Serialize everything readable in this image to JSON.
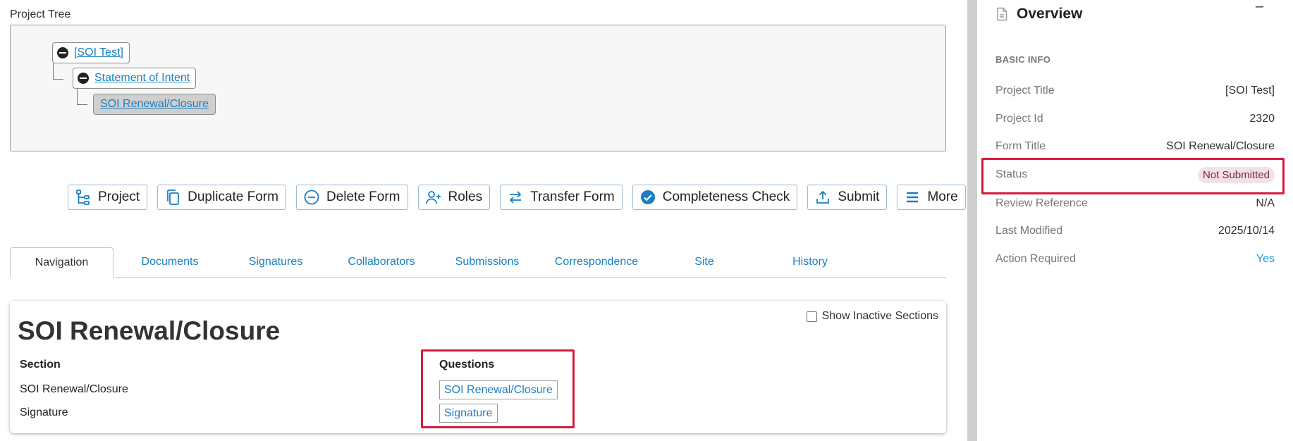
{
  "project_tree": {
    "label": "Project Tree",
    "nodes": [
      "[SOI Test]",
      "Statement of Intent",
      "SOI Renewal/Closure"
    ]
  },
  "toolbar": {
    "buttons": [
      {
        "label": "Project",
        "icon": "hierarchy-icon"
      },
      {
        "label": "Duplicate Form",
        "icon": "copy-icon"
      },
      {
        "label": "Delete Form",
        "icon": "minus-circle-icon"
      },
      {
        "label": "Roles",
        "icon": "user-plus-icon"
      },
      {
        "label": "Transfer Form",
        "icon": "transfer-arrows-icon"
      },
      {
        "label": "Completeness Check",
        "icon": "check-circle-icon"
      },
      {
        "label": "Submit",
        "icon": "upload-icon"
      },
      {
        "label": "More",
        "icon": "menu-icon"
      }
    ]
  },
  "tabs": [
    "Navigation",
    "Documents",
    "Signatures",
    "Collaborators",
    "Submissions",
    "Correspondence",
    "Site",
    "History"
  ],
  "active_tab": "Navigation",
  "form": {
    "title": "SOI Renewal/Closure",
    "show_inactive_label": "Show Inactive Sections",
    "section_header": "Section",
    "questions_header": "Questions",
    "sections": [
      "SOI Renewal/Closure",
      "Signature"
    ],
    "questions": [
      "SOI Renewal/Closure",
      "Signature"
    ]
  },
  "overview": {
    "title": "Overview",
    "collapse": "–",
    "basic_info_label": "BASIC INFO",
    "rows": [
      {
        "label": "Project Title",
        "value": "[SOI Test]"
      },
      {
        "label": "Project Id",
        "value": "2320"
      },
      {
        "label": "Form Title",
        "value": "SOI Renewal/Closure"
      },
      {
        "label": "Status",
        "value": "Not Submitted"
      },
      {
        "label": "Review Reference",
        "value": "N/A"
      },
      {
        "label": "Last Modified",
        "value": "2025/10/14"
      },
      {
        "label": "Action Required",
        "value": "Yes"
      }
    ]
  },
  "colors": {
    "link": "#1a7fc1",
    "highlight": "#d41c3b",
    "status_badge_bg": "#f2e1ea",
    "status_badge_text": "#7a2945"
  }
}
